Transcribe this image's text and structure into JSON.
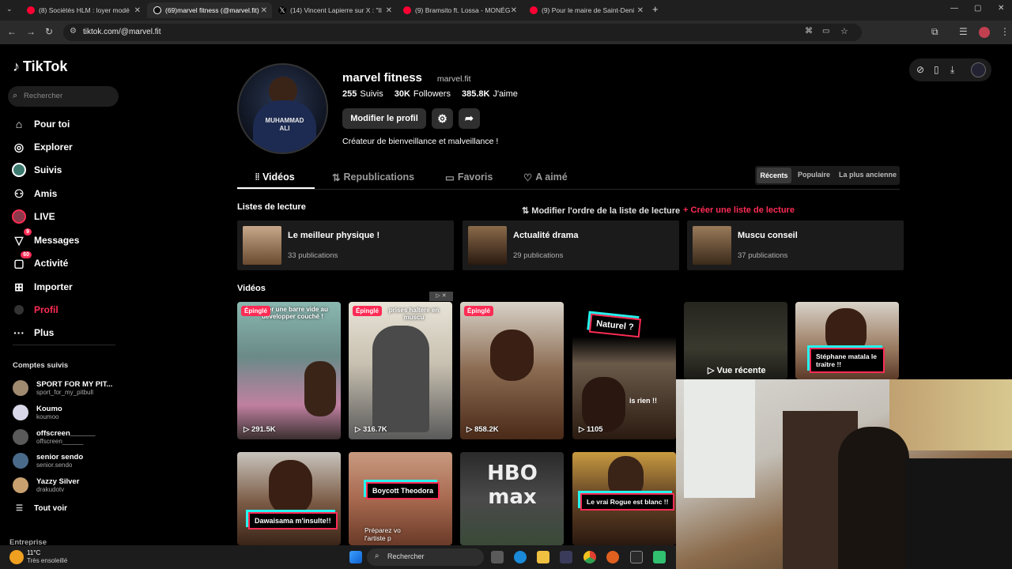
{
  "browser": {
    "tabs": [
      {
        "title": "(8) Sociétés HLM : loyer modé",
        "color": "#ff0033"
      },
      {
        "title": "(69)marvel fitness (@marvel.fit)",
        "color": "#ffffff"
      },
      {
        "title": "(14) Vincent Lapierre sur X : \"Il",
        "color": "#ffffff"
      },
      {
        "title": "(9) Bramsito ft. Lossa - MONÉG",
        "color": "#ff0033"
      },
      {
        "title": "(9) Pour le maire de Saint-Deni",
        "color": "#ff0033"
      }
    ],
    "url": "tiktok.com/@marvel.fit"
  },
  "sidebar": {
    "logo": "TikTok",
    "search_placeholder": "Rechercher",
    "nav": [
      {
        "label": "Pour toi",
        "icon": "home-icon"
      },
      {
        "label": "Explorer",
        "icon": "compass-icon"
      },
      {
        "label": "Suivis",
        "icon": "following-avatar-icon"
      },
      {
        "label": "Amis",
        "icon": "friends-icon"
      },
      {
        "label": "LIVE",
        "icon": "live-icon"
      },
      {
        "label": "Messages",
        "icon": "messages-icon",
        "badge": "9"
      },
      {
        "label": "Activité",
        "icon": "activity-icon",
        "badge": "60"
      },
      {
        "label": "Importer",
        "icon": "upload-icon"
      },
      {
        "label": "Profil",
        "icon": "profile-icon"
      },
      {
        "label": "Plus",
        "icon": "more-icon"
      }
    ],
    "following_title": "Comptes suivis",
    "following": [
      {
        "name": "SPORT FOR MY PIT...",
        "user": "sport_for_my_pitbull",
        "color": "#a08a70"
      },
      {
        "name": "Koumo",
        "user": "koumoo",
        "color": "#d8d8e8"
      },
      {
        "name": "offscreen______",
        "user": "offscreen______",
        "color": "#5a5a5a"
      },
      {
        "name": "senior sendo",
        "user": "senior.sendo",
        "color": "#4a6a8a"
      },
      {
        "name": "Yazzy Silver",
        "user": "drakudotv",
        "color": "#c8a070"
      }
    ],
    "see_all": "Tout voir",
    "footer": "Entreprise"
  },
  "profile": {
    "display_name": "marvel fitness",
    "username": "marvel.fit",
    "following_count": "255",
    "following_label": "Suivis",
    "followers_count": "30K",
    "followers_label": "Followers",
    "likes_count": "385.8K",
    "likes_label": "J'aime",
    "edit_button": "Modifier le profil",
    "bio": "Créateur de bienveillance et malveillance !",
    "avatar_text": "MUHAMMAD ALI"
  },
  "tabs": [
    {
      "label": "Vidéos",
      "active": true
    },
    {
      "label": "Republications"
    },
    {
      "label": "Favoris"
    },
    {
      "label": "A aimé"
    }
  ],
  "sort": [
    "Récents",
    "Populaire",
    "La plus ancienne"
  ],
  "playlists_title": "Listes de lecture",
  "reorder_label": "Modifier l'ordre de la liste de lecture",
  "create_label": "Créer une liste de lecture",
  "playlists": [
    {
      "title": "Le meilleur physique !",
      "count": "33 publications"
    },
    {
      "title": "Actualité drama",
      "count": "29 publications"
    },
    {
      "title": "Muscu conseil",
      "count": "37 publications"
    }
  ],
  "videos_title": "Vidéos",
  "pinned_label": "Épinglé",
  "recent_label": "Vue récente",
  "videos_row1": [
    {
      "views": "291.5K",
      "caption": "Lever une barre vide au développer couché !",
      "pinned": true
    },
    {
      "views": "316.7K",
      "caption": "prises haltere en muscu",
      "pinned": true
    },
    {
      "views": "858.2K",
      "caption": "",
      "pinned": true
    },
    {
      "views": "1105",
      "caption": "Naturel ?",
      "caption2": "is rien !!"
    },
    {
      "views": "",
      "caption": ""
    },
    {
      "views": "",
      "caption": "Stéphane matala le traitre !!"
    }
  ],
  "videos_row2": [
    {
      "caption": "Dawaisama m'insulte!!"
    },
    {
      "caption": "Boycott Theodora",
      "caption2": "Préparez vo l'artiste p"
    },
    {
      "caption": "HBO max"
    },
    {
      "caption": "Le vrai Rogue est blanc !!"
    }
  ],
  "taskbar": {
    "temp": "11°C",
    "weather": "Très ensoleillé",
    "search": "Rechercher"
  },
  "colors": {
    "accent": "#fe2c55",
    "cyan": "#25f4ee"
  }
}
